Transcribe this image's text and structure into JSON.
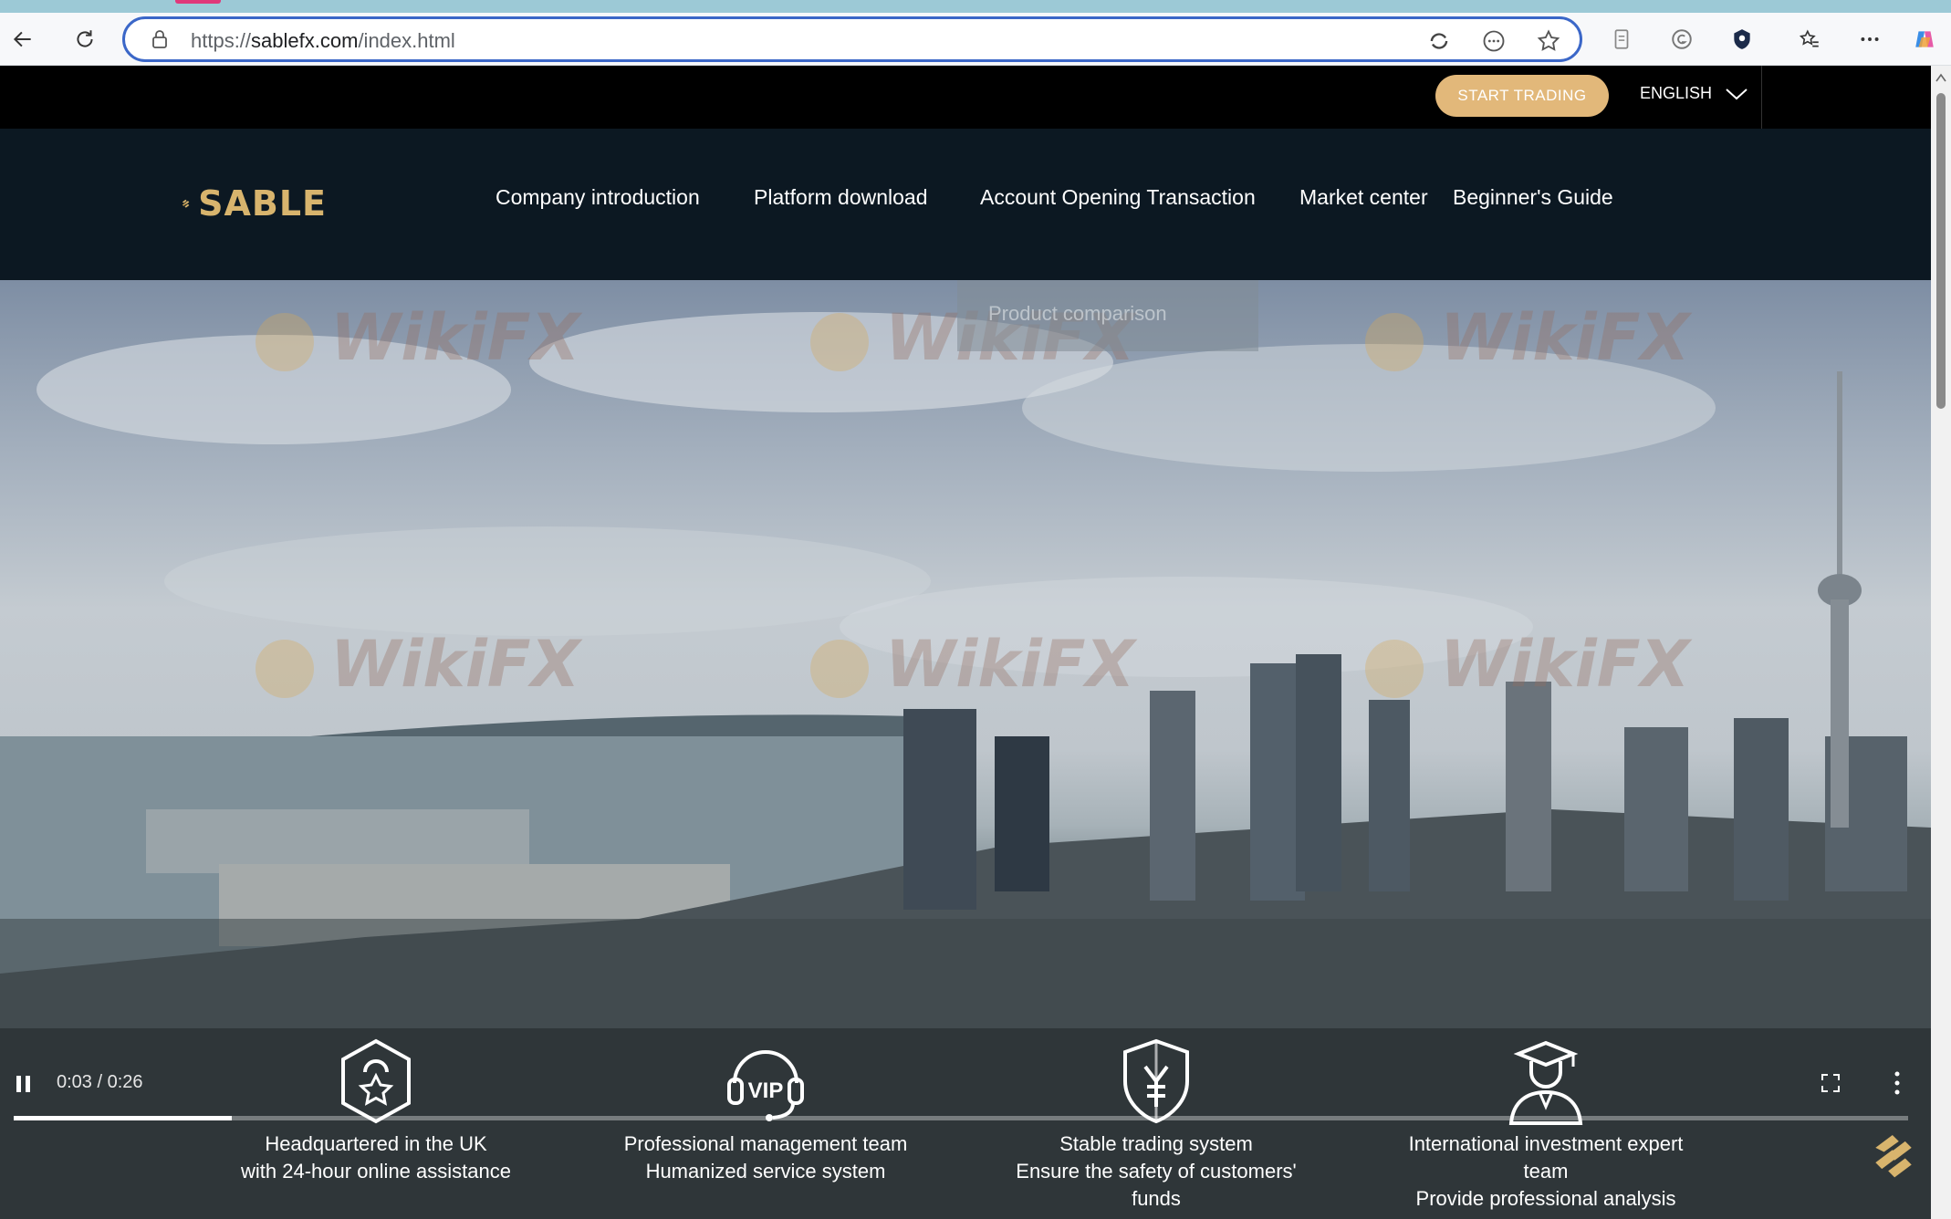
{
  "browser": {
    "url_prefix": "https://",
    "url_domain": "sablefx.com",
    "url_path": "/index.html",
    "icons": [
      "back-icon",
      "refresh-icon",
      "lock-icon",
      "copilot-read-icon",
      "more-tools-icon",
      "favorite-star-icon",
      "reading-view-icon",
      "grammarly-icon",
      "extension-shield-icon",
      "favorites-icon",
      "menu-dots-icon",
      "copilot-icon"
    ]
  },
  "topbar": {
    "start_trading": "START TRADING",
    "language": "ENGLISH"
  },
  "brand": {
    "name": "SABLE",
    "color": "#d8b46d"
  },
  "nav": {
    "items": [
      "Company introduction",
      "Platform download",
      "Account Opening Transaction",
      "Market center",
      "Beginner's Guide"
    ],
    "dropdown_item": "Product comparison"
  },
  "watermark": "WikiFX",
  "video": {
    "time": "0:03 / 0:26",
    "progress": 0.115
  },
  "features": [
    {
      "icon": "headquarters-star-icon",
      "line1": "Headquartered in the UK",
      "line2": "with 24-hour online assistance",
      "line3": ""
    },
    {
      "icon": "vip-headset-icon",
      "line1": "Professional management team",
      "line2": "Humanized service system",
      "line3": ""
    },
    {
      "icon": "yen-shield-icon",
      "line1": "Stable trading system",
      "line2": "Ensure the safety of customers'",
      "line3": "funds"
    },
    {
      "icon": "graduate-expert-icon",
      "line1": "International investment expert",
      "line2": "team",
      "line3": "Provide professional analysis"
    }
  ],
  "colors": {
    "accent_gold": "#e2b87a",
    "nav_bg": "#0c1822",
    "address_border": "#3b67c8"
  }
}
